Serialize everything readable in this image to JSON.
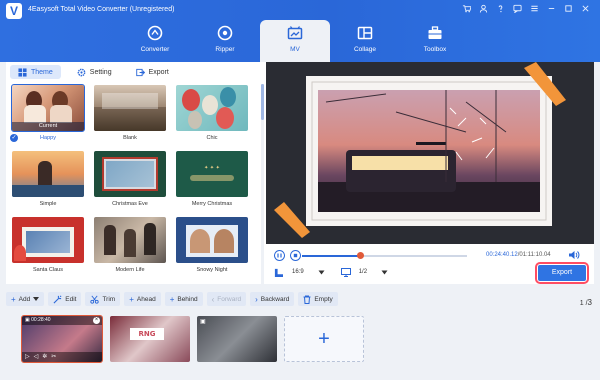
{
  "app": {
    "title": "4Easysoft Total Video Converter (Unregistered)",
    "logo_letter": "V",
    "window_controls": [
      "cart-icon",
      "user-icon",
      "question-icon",
      "feedback-icon",
      "menu-icon",
      "minimize-icon",
      "maximize-icon",
      "close-icon"
    ]
  },
  "nav": [
    {
      "label": "Converter",
      "icon": "converter-icon",
      "active": false
    },
    {
      "label": "Ripper",
      "icon": "ripper-icon",
      "active": false
    },
    {
      "label": "MV",
      "icon": "mv-icon",
      "active": true
    },
    {
      "label": "Collage",
      "icon": "collage-icon",
      "active": false
    },
    {
      "label": "Toolbox",
      "icon": "toolbox-icon",
      "active": false
    }
  ],
  "subtabs": [
    {
      "label": "Theme",
      "icon": "theme-icon",
      "active": true
    },
    {
      "label": "Setting",
      "icon": "gear-icon",
      "active": false
    },
    {
      "label": "Export",
      "icon": "export-icon",
      "active": false
    }
  ],
  "themes": [
    {
      "name": "Happy",
      "selected": true,
      "badge": "Current"
    },
    {
      "name": "Blank",
      "selected": false
    },
    {
      "name": "Chic",
      "selected": false
    },
    {
      "name": "Simple",
      "selected": false
    },
    {
      "name": "Christmas Eve",
      "selected": false
    },
    {
      "name": "Merry Christmas",
      "selected": false
    },
    {
      "name": "Santa Claus",
      "selected": false
    },
    {
      "name": "Modern Life",
      "selected": false
    },
    {
      "name": "Snowy Night",
      "selected": false
    }
  ],
  "player": {
    "current_time": "00:24:40.12",
    "total_time": "01:11:10.04",
    "progress": 0.35,
    "aspect_ratio": "16:9",
    "zoom": "1/2",
    "export_label": "Export"
  },
  "toolbar": {
    "add": "Add",
    "edit": "Edit",
    "trim": "Trim",
    "ahead": "Ahead",
    "behind": "Behind",
    "forward": "Forward",
    "backward": "Backward",
    "empty": "Empty",
    "page_current": "1",
    "page_total": "3"
  },
  "clips": [
    {
      "duration": "00:28:40",
      "selected": true
    },
    {
      "duration": "",
      "selected": false
    },
    {
      "duration": "",
      "selected": false
    }
  ],
  "colors": {
    "accent": "#2a67d8",
    "header": "#2f6fe0",
    "highlight": "#ff4d63",
    "knob": "#e05a3a"
  }
}
